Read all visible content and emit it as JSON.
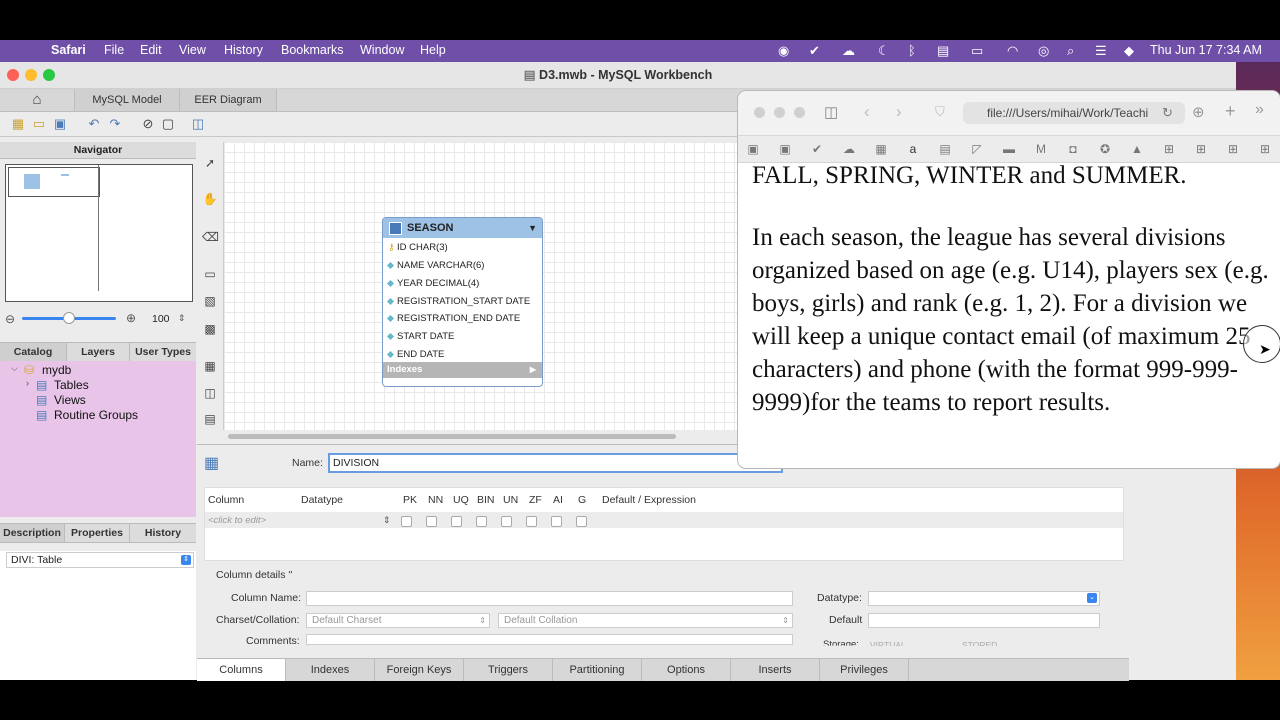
{
  "menubar": {
    "app": "Safari",
    "items": [
      "File",
      "Edit",
      "View",
      "History",
      "Bookmarks",
      "Window",
      "Help"
    ],
    "clock": "Thu Jun 17  7:34 AM"
  },
  "workbench": {
    "title": "D3.mwb - MySQL Workbench",
    "tabs": [
      "MySQL Model",
      "EER Diagram"
    ],
    "navigator": {
      "header": "Navigator",
      "zoom": "100"
    },
    "catalog_tabs": [
      "Catalog",
      "Layers",
      "User Types"
    ],
    "tree": {
      "root": "mydb",
      "children": [
        "Tables",
        "Views",
        "Routine Groups"
      ]
    },
    "desc_tabs": [
      "Description",
      "Properties",
      "History"
    ],
    "desc_select": "DIVI: Table",
    "season": {
      "name": "SEASON",
      "columns": [
        "ID CHAR(3)",
        "NAME VARCHAR(6)",
        "YEAR DECIMAL(4)",
        "REGISTRATION_START DATE",
        "REGISTRATION_END DATE",
        "START DATE",
        "END DATE"
      ],
      "indexes_label": "Indexes"
    },
    "editor": {
      "name_label": "Name:",
      "name_value": "DIVISION",
      "grid_headers": [
        "Column",
        "Datatype",
        "PK",
        "NN",
        "UQ",
        "BIN",
        "UN",
        "ZF",
        "AI",
        "G",
        "Default / Expression"
      ],
      "placeholder_row": "<click to edit>",
      "details_title": "Column details ''",
      "column_name_label": "Column Name:",
      "charset_label": "Charset/Collation:",
      "charset_value": "Default Charset",
      "collation_value": "Default Collation",
      "comments_label": "Comments:",
      "datatype_label": "Datatype:",
      "default_label": "Default",
      "storage_label": "Storage:",
      "storage_options": [
        "VIRTUAL",
        "STORED"
      ]
    },
    "bottom_tabs": [
      "Columns",
      "Indexes",
      "Foreign Keys",
      "Triggers",
      "Partitioning",
      "Options",
      "Inserts",
      "Privileges"
    ]
  },
  "safari": {
    "url": "file:///Users/mihai/Work/Teachi",
    "paragraphs": [
      "FALL, SPRING, WINTER and SUMMER.",
      "In each season, the league has several divisions organized based on age (e.g. U14), players sex (e.g. boys, girls) and rank (e.g. 1, 2). For a division we will keep a unique contact email (of maximum 25 characters) and phone (with the format 999-999-9999)for the teams to report results."
    ]
  },
  "colors": {
    "menubar": "#6f4fa8",
    "catalog_bg": "#e8c5e8",
    "table_header": "#9ec1e6",
    "focus_blue": "#6a9de0"
  }
}
